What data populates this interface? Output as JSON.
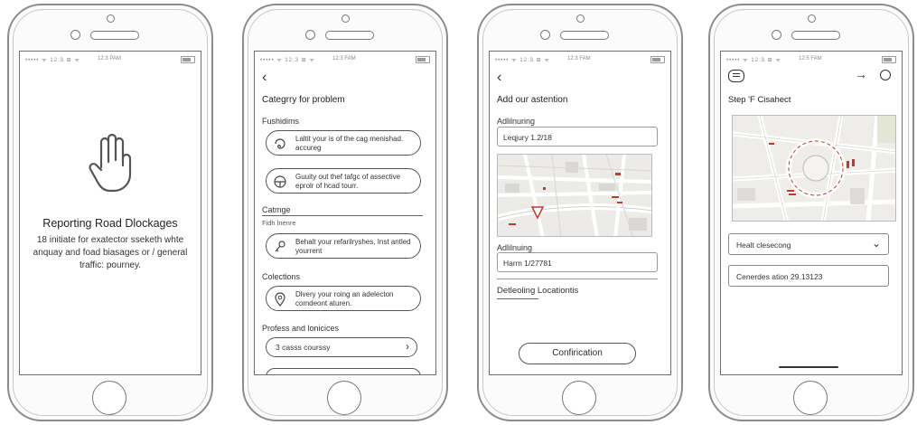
{
  "status_bar": {
    "signal": "••••• ᯤ 12:3 ⊞ ᯤ",
    "time": "12:3 PAM",
    "time2": "12:3 FAM",
    "time3": "12:5 FAM"
  },
  "screen1": {
    "heading": "Reporting Road Dlockages",
    "body": "18 initiate for exatector sseketh whte anquay and foad biasages or / general traffic: pourney."
  },
  "screen2": {
    "title": "Categrry for problem",
    "section1": "Fushidims",
    "item1": "Laltit your is of the cag menishad. accureg",
    "item2": "Guuity out thef tafgc of assective eprolr of hcad tourr.",
    "section2": "Catmge",
    "section2_sub": "Fidh lnenre",
    "item3": "Behalt your refarilryshes, Inst antled yourrent",
    "section3": "Colections",
    "item4": "Dlvery your roing an adelecton comdeont aturen.",
    "section4": "Profess and lonicices",
    "select_value": "3 casss courssy"
  },
  "screen3": {
    "title": "Add our astention",
    "label1": "Adlilnuring",
    "field1": "Leqjury 1.2/18",
    "label2": "Adlilnuing",
    "field2": "Harm 1/27781",
    "section": "Detleoling Locationtis",
    "button": "Confirication"
  },
  "screen4": {
    "title": "Step 'F Cisahect",
    "select_value": "Healt clesecong",
    "field": "Cenerdes ation 29.13123"
  },
  "colors": {
    "accent_red": "#c0392b",
    "stroke": "#555555"
  }
}
